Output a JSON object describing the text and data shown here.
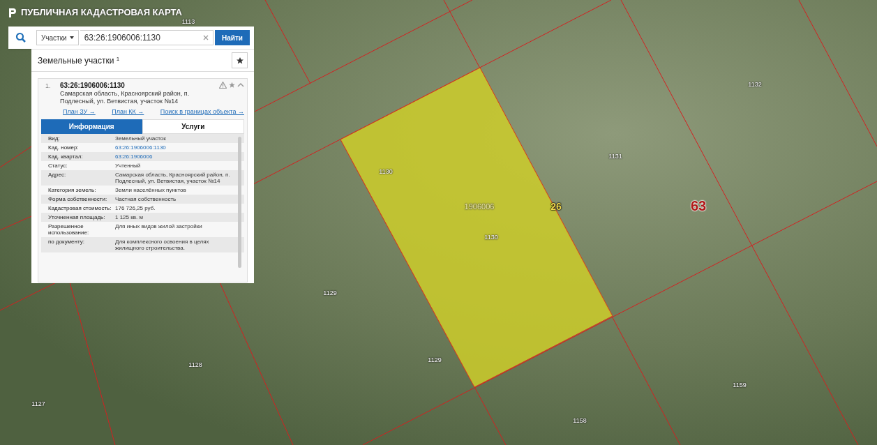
{
  "app": {
    "title": "ПУБЛИЧНАЯ КАДАСТРОВАЯ КАРТА"
  },
  "search": {
    "category": "Участки",
    "value": "63:26:1906006:1130",
    "button": "Найти"
  },
  "results": {
    "title": "Земельные участки",
    "count": "1",
    "items": [
      {
        "index": "1.",
        "number": "63:26:1906006:1130",
        "address": "Самарская область, Красноярский район, п. Подлесный, ул. Ветвистая, участок №14",
        "links": [
          "План ЗУ →",
          "План КК →",
          "Поиск в границах объекта →"
        ],
        "tabs": [
          {
            "label": "Информация",
            "selected": true
          },
          {
            "label": "Услуги",
            "selected": false
          }
        ],
        "fields": [
          {
            "label": "Вид:",
            "value": "Земельный участок",
            "kind": "text"
          },
          {
            "label": "Кад. номер:",
            "value": "63:26:1906006:1130",
            "kind": "link"
          },
          {
            "label": "Кад. квартал:",
            "value": "63:26:1906006",
            "kind": "link"
          },
          {
            "label": "Статус:",
            "value": "Учтенный",
            "kind": "text"
          },
          {
            "label": "Адрес:",
            "value": "Самарская область, Красноярский район, п. Подлесный, ул. Ветвистая, участок №14",
            "kind": "text"
          },
          {
            "label": "Категория земель:",
            "value": "Земли населённых пунктов",
            "kind": "text"
          },
          {
            "label": "Форма собственности:",
            "value": "Частная собственность",
            "kind": "text"
          },
          {
            "label": "Кадастровая стоимость:",
            "value": "176 726,25 руб.",
            "kind": "text"
          },
          {
            "label": "Уточненная площадь:",
            "value": "1 125 кв. м",
            "kind": "text"
          },
          {
            "label": "Разрешенное использование:",
            "value": "Для иных видов жилой застройки",
            "kind": "text"
          },
          {
            "label": "по документу:",
            "value": "Для комплексного освоения в целях жилищного строительства.",
            "kind": "text"
          }
        ]
      }
    ]
  },
  "map": {
    "labels": [
      {
        "text": "1113",
        "kind": "parcel"
      },
      {
        "text": "1132",
        "kind": "parcel"
      },
      {
        "text": "1131",
        "kind": "parcel"
      },
      {
        "text": "1130",
        "kind": "parcel"
      },
      {
        "text": "1906006",
        "kind": "quarter"
      },
      {
        "text": "26",
        "kind": "region"
      },
      {
        "text": "63",
        "kind": "district"
      },
      {
        "text": "1130",
        "kind": "parcel"
      },
      {
        "text": "1129",
        "kind": "parcel"
      },
      {
        "text": "1129",
        "kind": "parcel"
      },
      {
        "text": "1128",
        "kind": "parcel"
      },
      {
        "text": "1127",
        "kind": "parcel"
      },
      {
        "text": "1159",
        "kind": "parcel"
      },
      {
        "text": "1158",
        "kind": "parcel"
      }
    ]
  }
}
